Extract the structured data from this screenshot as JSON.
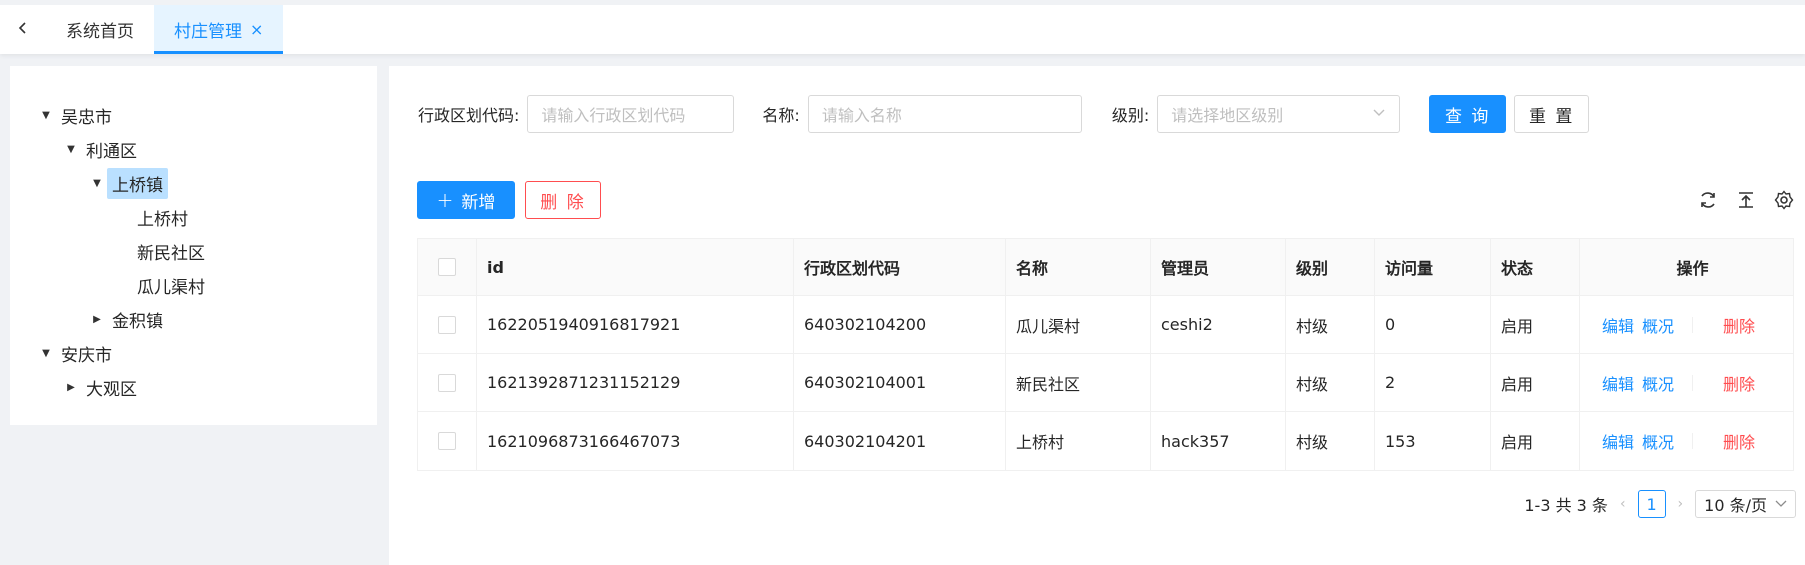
{
  "tabs": {
    "back_icon": "chevron-left-icon",
    "items": [
      {
        "label": "系统首页"
      },
      {
        "label": "村庄管理",
        "close": "×"
      }
    ]
  },
  "tree": [
    {
      "label": "吴忠市",
      "expanded": true
    },
    {
      "label": "利通区",
      "expanded": true
    },
    {
      "label": "上桥镇",
      "expanded": true,
      "selected": true
    },
    {
      "label": "上桥村"
    },
    {
      "label": "新民社区"
    },
    {
      "label": "瓜儿渠村"
    },
    {
      "label": "金积镇",
      "expanded": false
    },
    {
      "label": "安庆市",
      "expanded": true
    },
    {
      "label": "大观区",
      "expanded": false
    }
  ],
  "search": {
    "code_label": "行政区划代码:",
    "code_placeholder": "请输入行政区划代码",
    "name_label": "名称:",
    "name_placeholder": "请输入名称",
    "level_label": "级别:",
    "level_placeholder": "请选择地区级别",
    "query_button": "查 询",
    "reset_button": "重 置"
  },
  "toolbar": {
    "add_button": "新增",
    "add_icon": "+",
    "delete_button": "删 除",
    "icons": [
      "refresh-icon",
      "export-icon",
      "settings-icon"
    ]
  },
  "table": {
    "columns": [
      "id",
      "行政区划代码",
      "名称",
      "管理员",
      "级别",
      "访问量",
      "状态",
      "操作"
    ],
    "rows": [
      {
        "id": "1622051940916817921",
        "code": "640302104200",
        "name": "瓜儿渠村",
        "admin": "ceshi2",
        "level": "村级",
        "visits": "0",
        "status": "启用"
      },
      {
        "id": "1621392871231152129",
        "code": "640302104001",
        "name": "新民社区",
        "admin": "",
        "level": "村级",
        "visits": "2",
        "status": "启用"
      },
      {
        "id": "1621096873166467073",
        "code": "640302104201",
        "name": "上桥村",
        "admin": "hack357",
        "level": "村级",
        "visits": "153",
        "status": "启用"
      }
    ],
    "ops": {
      "edit": "编辑",
      "overview": "概况",
      "delete": "删除"
    }
  },
  "pagination": {
    "total_text": "1-3 共 3 条",
    "current_page": "1",
    "prev": "‹",
    "next": "›",
    "page_size": "10 条/页"
  },
  "colors": {
    "primary": "#1890ff",
    "danger": "#ff4d4f",
    "selected_bg": "#bae0ff"
  }
}
